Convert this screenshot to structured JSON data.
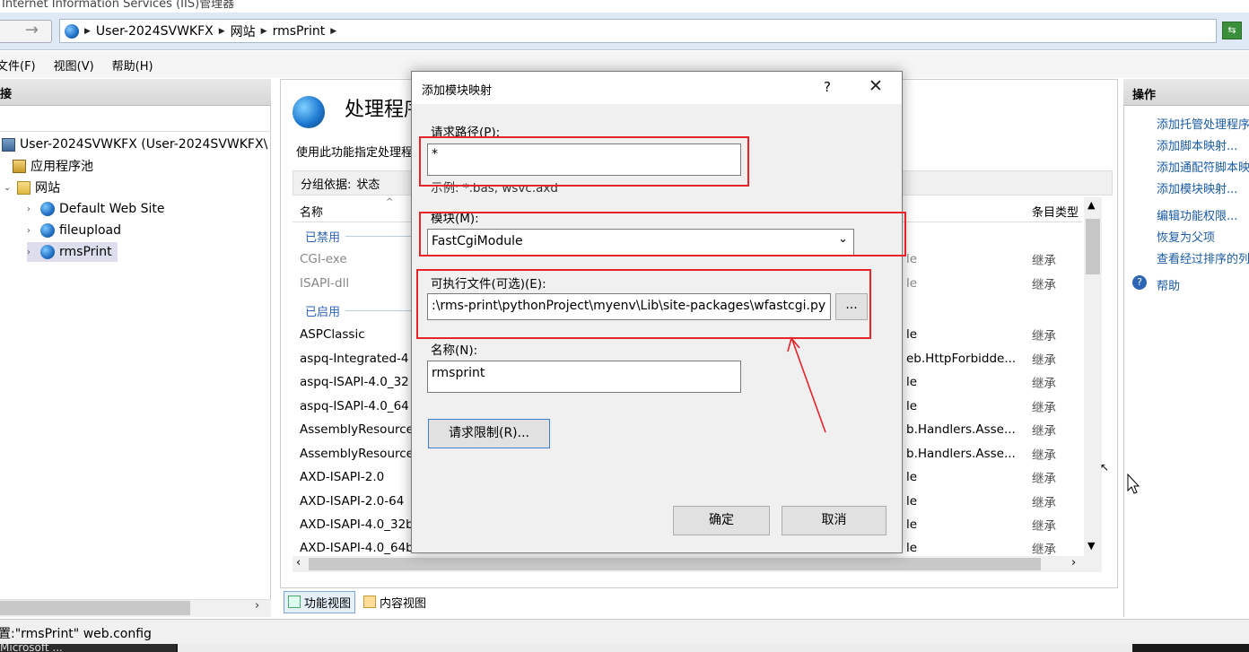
{
  "window": {
    "title": "Internet Information Services (IIS)管理器"
  },
  "address": {
    "crumbs": [
      "User-2024SVWKFX",
      "网站",
      "rmsPrint"
    ]
  },
  "menu": {
    "items": [
      "文件(F)",
      "视图(V)",
      "帮助(H)"
    ]
  },
  "left": {
    "header": "接",
    "tree": [
      {
        "label": "User-2024SVWKFX (User-2024SVWKFX\\"
      },
      {
        "label": "应用程序池"
      },
      {
        "label": "网站"
      },
      {
        "label": "Default Web Site"
      },
      {
        "label": "fileupload"
      },
      {
        "label": "rmsPrint"
      }
    ]
  },
  "center": {
    "title": "处理程序映射",
    "desc": "使用此功能指定处理程序",
    "group_label": "分组依据:",
    "group_value": "状态",
    "col_name": "名称",
    "col_type": "条目类型",
    "group_disabled": "已禁用",
    "group_enabled": "已启用",
    "rows": [
      {
        "name": "CGI-exe",
        "path": "le",
        "type": "继承"
      },
      {
        "name": "ISAPI-dll",
        "path": "le",
        "type": "继承"
      },
      {
        "name": "ASPClassic",
        "path": "le",
        "type": "继承"
      },
      {
        "name": "aspq-Integrated-4",
        "path": "eb.HttpForbidde...",
        "type": "继承"
      },
      {
        "name": "aspq-ISAPI-4.0_32",
        "path": "le",
        "type": "继承"
      },
      {
        "name": "aspq-ISAPI-4.0_64",
        "path": "le",
        "type": "继承"
      },
      {
        "name": "AssemblyResourceL",
        "path": "b.Handlers.Asse...",
        "type": "继承"
      },
      {
        "name": "AssemblyResourceL",
        "path": "b.Handlers.Asse...",
        "type": "继承"
      },
      {
        "name": "AXD-ISAPI-2.0",
        "path": "le",
        "type": "继承"
      },
      {
        "name": "AXD-ISAPI-2.0-64",
        "path": "le",
        "type": "继承"
      },
      {
        "name": "AXD-ISAPI-4.0_32b",
        "path": "le",
        "type": "继承"
      },
      {
        "name": "AXD-ISAPI-4.0_64b",
        "path": "le",
        "type": "继承"
      }
    ],
    "tab_feature": "功能视图",
    "tab_content": "内容视图"
  },
  "right": {
    "header": "操作",
    "actions": [
      "添加托管处理程序...",
      "添加脚本映射...",
      "添加通配符脚本映射...",
      "添加模块映射...",
      "编辑功能权限...",
      "恢复为父项",
      "查看经过排序的列表..."
    ],
    "help": "帮助"
  },
  "status": {
    "text": "置:\"rmsPrint\" web.config"
  },
  "taskbar": {
    "item": "Microsoft ..."
  },
  "dialog": {
    "title": "添加模块映射",
    "help": "?",
    "close": "✕",
    "path_label": "请求路径(P):",
    "path_value": "*",
    "path_example": "示例: *.bas, wsvc.axd",
    "module_label": "模块(M):",
    "module_value": "FastCgiModule",
    "exe_label": "可执行文件(可选)(E):",
    "exe_value": ":\\rms-print\\pythonProject\\myenv\\Lib\\site-packages\\wfastcgi.py",
    "browse": "...",
    "name_label": "名称(N):",
    "name_value": "rmsprint",
    "restrict_btn": "请求限制(R)...",
    "ok": "确定",
    "cancel": "取消"
  },
  "colors": {
    "annotation_red": "#e8232a",
    "link_blue": "#1a5ba6"
  }
}
